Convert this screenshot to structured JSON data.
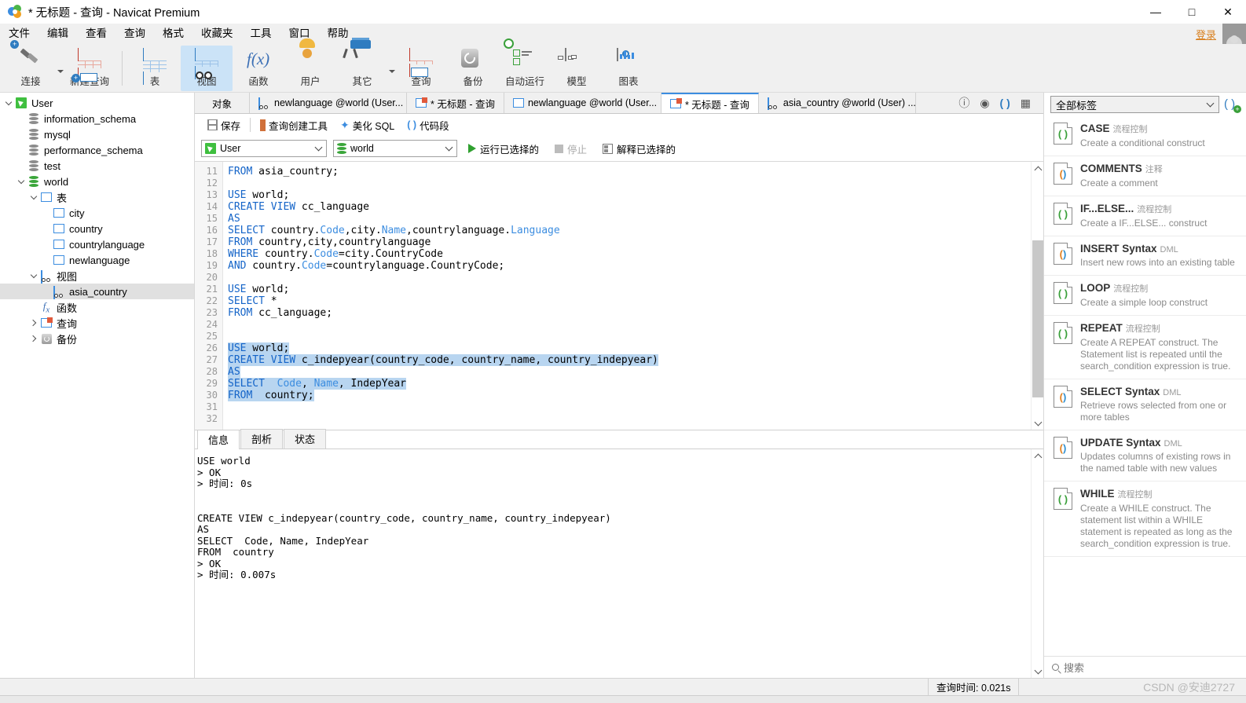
{
  "window": {
    "title": "* 无标题 - 查询 - Navicat Premium",
    "minimize": "—",
    "maximize": "□",
    "close": "✕"
  },
  "menubar": {
    "items": [
      "文件",
      "编辑",
      "查看",
      "查询",
      "格式",
      "收藏夹",
      "工具",
      "窗口",
      "帮助"
    ],
    "login_label": "登录"
  },
  "toolbar": {
    "items": [
      {
        "label": "连接",
        "icon": "connection-icon",
        "has_dropdown": true
      },
      {
        "label": "新建查询",
        "icon": "new-query-icon",
        "has_dropdown": false
      },
      {
        "label": "表",
        "icon": "table-icon",
        "has_dropdown": false
      },
      {
        "label": "视图",
        "icon": "view-icon",
        "has_dropdown": false,
        "active": true
      },
      {
        "label": "函数",
        "icon": "function-icon",
        "has_dropdown": false
      },
      {
        "label": "用户",
        "icon": "user-icon",
        "has_dropdown": false
      },
      {
        "label": "其它",
        "icon": "other-icon",
        "has_dropdown": true
      },
      {
        "label": "查询",
        "icon": "query-icon",
        "has_dropdown": false
      },
      {
        "label": "备份",
        "icon": "backup-icon",
        "has_dropdown": false
      },
      {
        "label": "自动运行",
        "icon": "automation-icon",
        "has_dropdown": false
      },
      {
        "label": "模型",
        "icon": "model-icon",
        "has_dropdown": false
      },
      {
        "label": "图表",
        "icon": "chart-icon",
        "has_dropdown": false
      }
    ]
  },
  "sidebar": {
    "nodes": [
      {
        "label": "User",
        "indent": 0,
        "twisty": "down",
        "icon": "navicat-connection-icon"
      },
      {
        "label": "information_schema",
        "indent": 1,
        "twisty": "",
        "icon": "database-gray-icon"
      },
      {
        "label": "mysql",
        "indent": 1,
        "twisty": "",
        "icon": "database-gray-icon"
      },
      {
        "label": "performance_schema",
        "indent": 1,
        "twisty": "",
        "icon": "database-gray-icon"
      },
      {
        "label": "test",
        "indent": 1,
        "twisty": "",
        "icon": "database-gray-icon"
      },
      {
        "label": "world",
        "indent": 1,
        "twisty": "down",
        "icon": "database-green-icon"
      },
      {
        "label": "表",
        "indent": 2,
        "twisty": "down",
        "icon": "tables-folder-icon"
      },
      {
        "label": "city",
        "indent": 3,
        "twisty": "",
        "icon": "table-icon"
      },
      {
        "label": "country",
        "indent": 3,
        "twisty": "",
        "icon": "table-icon"
      },
      {
        "label": "countrylanguage",
        "indent": 3,
        "twisty": "",
        "icon": "table-icon"
      },
      {
        "label": "newlanguage",
        "indent": 3,
        "twisty": "",
        "icon": "table-icon"
      },
      {
        "label": "视图",
        "indent": 2,
        "twisty": "down",
        "icon": "views-folder-icon"
      },
      {
        "label": "asia_country",
        "indent": 3,
        "twisty": "",
        "icon": "view-icon",
        "selected": true
      },
      {
        "label": "函数",
        "indent": 2,
        "twisty": "",
        "icon": "function-icon"
      },
      {
        "label": "查询",
        "indent": 2,
        "twisty": "right",
        "icon": "query-folder-icon"
      },
      {
        "label": "备份",
        "indent": 2,
        "twisty": "right",
        "icon": "backup-folder-icon"
      }
    ]
  },
  "tabbar": {
    "object_tab": "对象",
    "tabs": [
      {
        "label": "newlanguage @world (User...",
        "icon": "view-design-icon",
        "active": false
      },
      {
        "label": "* 无标题 - 查询",
        "icon": "query-icon",
        "active": false
      },
      {
        "label": "newlanguage @world (User...",
        "icon": "table-icon",
        "active": false
      },
      {
        "label": "* 无标题 - 查询",
        "icon": "query-icon",
        "active": true
      },
      {
        "label": "asia_country @world (User) ...",
        "icon": "view-design-icon",
        "active": false
      }
    ],
    "right_icons": [
      "info-icon",
      "preview-eye-icon",
      "code-snippet-icon",
      "grid-layout-icon"
    ]
  },
  "query_toolbar": {
    "save": "保存",
    "query_builder": "查询创建工具",
    "beautify_sql": "美化 SQL",
    "code_snippet": "代码段",
    "connection_value": "User",
    "database_value": "world",
    "run_selected": "运行已选择的",
    "stop": "停止",
    "explain_selected": "解释已选择的"
  },
  "editor": {
    "first_line_number": 11,
    "lines": [
      {
        "n": 11,
        "tokens": [
          {
            "t": "FROM",
            "c": "kw"
          },
          {
            "t": " asia_country;",
            "c": ""
          }
        ]
      },
      {
        "n": 12,
        "tokens": []
      },
      {
        "n": 13,
        "tokens": [
          {
            "t": "USE",
            "c": "kw"
          },
          {
            "t": " world;",
            "c": ""
          }
        ]
      },
      {
        "n": 14,
        "tokens": [
          {
            "t": "CREATE VIEW",
            "c": "kw"
          },
          {
            "t": " cc_language",
            "c": ""
          }
        ]
      },
      {
        "n": 15,
        "tokens": [
          {
            "t": "AS",
            "c": "kw"
          }
        ]
      },
      {
        "n": 16,
        "tokens": [
          {
            "t": "SELECT",
            "c": "kw"
          },
          {
            "t": " country.",
            "c": ""
          },
          {
            "t": "Code",
            "c": "col"
          },
          {
            "t": ",city.",
            "c": ""
          },
          {
            "t": "Name",
            "c": "col"
          },
          {
            "t": ",countrylanguage.",
            "c": ""
          },
          {
            "t": "Language",
            "c": "col"
          }
        ]
      },
      {
        "n": 17,
        "tokens": [
          {
            "t": "FROM",
            "c": "kw"
          },
          {
            "t": " country,city,countrylanguage",
            "c": ""
          }
        ]
      },
      {
        "n": 18,
        "tokens": [
          {
            "t": "WHERE",
            "c": "kw"
          },
          {
            "t": " country.",
            "c": ""
          },
          {
            "t": "Code",
            "c": "col"
          },
          {
            "t": "=city.CountryCode",
            "c": ""
          }
        ]
      },
      {
        "n": 19,
        "tokens": [
          {
            "t": "AND",
            "c": "kw"
          },
          {
            "t": " country.",
            "c": ""
          },
          {
            "t": "Code",
            "c": "col"
          },
          {
            "t": "=countrylanguage.CountryCode;",
            "c": ""
          }
        ]
      },
      {
        "n": 20,
        "tokens": []
      },
      {
        "n": 21,
        "tokens": [
          {
            "t": "USE",
            "c": "kw"
          },
          {
            "t": " world;",
            "c": ""
          }
        ]
      },
      {
        "n": 22,
        "tokens": [
          {
            "t": "SELECT",
            "c": "kw"
          },
          {
            "t": " *",
            "c": ""
          }
        ]
      },
      {
        "n": 23,
        "tokens": [
          {
            "t": "FROM",
            "c": "kw"
          },
          {
            "t": " cc_language;",
            "c": ""
          }
        ]
      },
      {
        "n": 24,
        "tokens": []
      },
      {
        "n": 25,
        "tokens": []
      },
      {
        "n": 26,
        "selected": true,
        "caret": true,
        "tokens": [
          {
            "t": "USE",
            "c": "kw"
          },
          {
            "t": " world;",
            "c": ""
          }
        ]
      },
      {
        "n": 27,
        "selected": true,
        "tokens": [
          {
            "t": "CREATE VIEW",
            "c": "kw"
          },
          {
            "t": " c_indepyear(country_code, country_name, country_indepyear)",
            "c": ""
          }
        ]
      },
      {
        "n": 28,
        "selected": true,
        "tokens": [
          {
            "t": "AS",
            "c": "kw"
          }
        ]
      },
      {
        "n": 29,
        "selected": true,
        "tokens": [
          {
            "t": "SELECT",
            "c": "kw"
          },
          {
            "t": "  ",
            "c": ""
          },
          {
            "t": "Code",
            "c": "col"
          },
          {
            "t": ", ",
            "c": ""
          },
          {
            "t": "Name",
            "c": "col"
          },
          {
            "t": ", IndepYear",
            "c": ""
          }
        ]
      },
      {
        "n": 30,
        "selected": true,
        "tokens": [
          {
            "t": "FROM",
            "c": "kw"
          },
          {
            "t": "  country;",
            "c": ""
          }
        ]
      },
      {
        "n": 31,
        "tokens": []
      },
      {
        "n": 32,
        "tokens": []
      }
    ]
  },
  "results": {
    "tabs": [
      "信息",
      "剖析",
      "状态"
    ],
    "active_tab": "信息",
    "output": "USE world\n> OK\n> 时间: 0s\n\n\nCREATE VIEW c_indepyear(country_code, country_name, country_indepyear)\nAS\nSELECT  Code, Name, IndepYear\nFROM  country\n> OK\n> 时间: 0.007s"
  },
  "snippets": {
    "filter_value": "全部标签",
    "search_placeholder": "搜索",
    "items": [
      {
        "title": "CASE",
        "tag": "流程控制",
        "desc": "Create a conditional construct",
        "color": "green"
      },
      {
        "title": "COMMENTS",
        "tag": "注释",
        "desc": "Create a comment",
        "color": "mix"
      },
      {
        "title": "IF...ELSE...",
        "tag": "流程控制",
        "desc": "Create a IF...ELSE... construct",
        "color": "green"
      },
      {
        "title": "INSERT Syntax",
        "tag": "DML",
        "desc": "Insert new rows into an existing table",
        "color": "mix"
      },
      {
        "title": "LOOP",
        "tag": "流程控制",
        "desc": "Create a simple loop construct",
        "color": "green"
      },
      {
        "title": "REPEAT",
        "tag": "流程控制",
        "desc": "Create A REPEAT construct. The Statement list is repeated until the search_condition expression is true.",
        "color": "green"
      },
      {
        "title": "SELECT Syntax",
        "tag": "DML",
        "desc": "Retrieve rows selected from one or more tables",
        "color": "mix"
      },
      {
        "title": "UPDATE Syntax",
        "tag": "DML",
        "desc": "Updates columns of existing rows in the named table with new values",
        "color": "mix"
      },
      {
        "title": "WHILE",
        "tag": "流程控制",
        "desc": "Create a WHILE construct. The statement list within a WHILE statement is repeated as long as the search_condition expression is true.",
        "color": "green"
      }
    ]
  },
  "statusbar": {
    "query_time": "查询时间: 0.021s",
    "watermark": "CSDN @安迪2727"
  },
  "colors": {
    "accent": "#3c8de0",
    "keyword": "#1464c8",
    "selection": "#b8d5f0",
    "active_toolbar": "#cbe3f7",
    "green": "#3aa03a",
    "orange": "#e08020"
  }
}
